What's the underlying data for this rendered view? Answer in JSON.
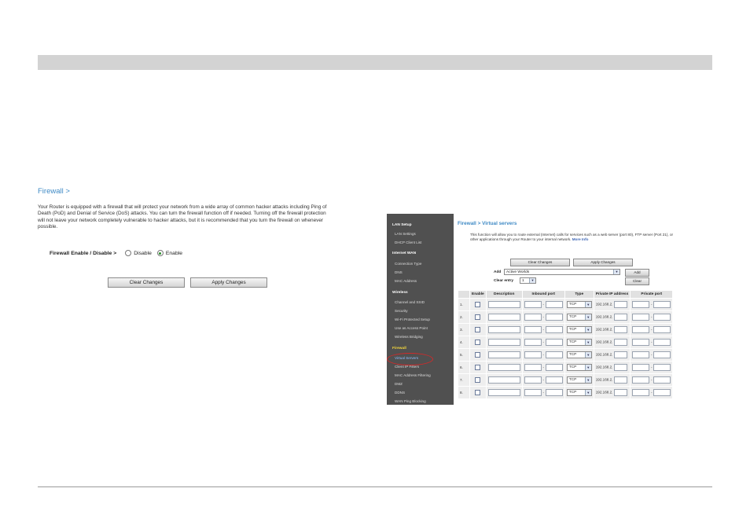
{
  "firewall": {
    "title": "Firewall >",
    "description": "Your Router is equipped with a firewall that will protect your network from a wide array of common hacker attacks including Ping of Death (PoD) and Denial of Service (DoS) attacks. You can turn the firewall function off if needed. Turning off the firewall protection will not leave your network completely vulnerable to hacker attacks, but it is recommended that you turn the firewall on whenever possible.",
    "toggle_label": "Firewall Enable / Disable >",
    "disable_label": "Disable",
    "enable_label": "Enable",
    "selected": "Enable",
    "clear_label": "Clear Changes",
    "apply_label": "Apply Changes"
  },
  "sidebar": {
    "sections": [
      {
        "label": "LAN Setup",
        "items": [
          "LAN Settings",
          "DHCP Client List"
        ]
      },
      {
        "label": "Internet WAN",
        "items": [
          "Connection Type",
          "DNS",
          "MAC Address"
        ]
      },
      {
        "label": "Wireless",
        "items": [
          "Channel and SSID",
          "Security",
          "Wi-Fi Protected Setup",
          "Use as Access Point",
          "Wireless Bridging"
        ]
      },
      {
        "label": "Firewall",
        "items": [
          "Virtual Servers",
          "Client IP Filters",
          "MAC Address Filtering",
          "DMZ",
          "DDNS",
          "WAN Ping Blocking"
        ]
      }
    ],
    "active_item": "Virtual Servers"
  },
  "virtual_servers": {
    "title": "Firewall > Virtual servers",
    "description": "This function will allow you to route external (Internet) calls for services such as a web server (port 80), FTP server (Port 21), or other applications through your Router to your internal network.",
    "more_info": "More Info",
    "clear_label": "Clear Changes",
    "apply_label": "Apply Changes",
    "add_label": "Add",
    "add_value": "Active Worlds",
    "add_button": "Add",
    "clear_entry_label": "Clear entry",
    "clear_entry_value": "1",
    "clear_button": "Clear",
    "columns": [
      "Enable",
      "Description",
      "Inbound port",
      "Type",
      "Private IP address",
      "Private port"
    ],
    "rows": [
      {
        "num": "1.",
        "type": "TCP",
        "ip_prefix": "192.168.2."
      },
      {
        "num": "2.",
        "type": "TCP",
        "ip_prefix": "192.168.2."
      },
      {
        "num": "3.",
        "type": "TCP",
        "ip_prefix": "192.168.2."
      },
      {
        "num": "4.",
        "type": "TCP",
        "ip_prefix": "192.168.2."
      },
      {
        "num": "5.",
        "type": "TCP",
        "ip_prefix": "192.168.2."
      },
      {
        "num": "6.",
        "type": "TCP",
        "ip_prefix": "192.168.2."
      },
      {
        "num": "7.",
        "type": "TCP",
        "ip_prefix": "192.168.2."
      },
      {
        "num": "8.",
        "type": "TCP",
        "ip_prefix": "192.168.2."
      }
    ]
  }
}
